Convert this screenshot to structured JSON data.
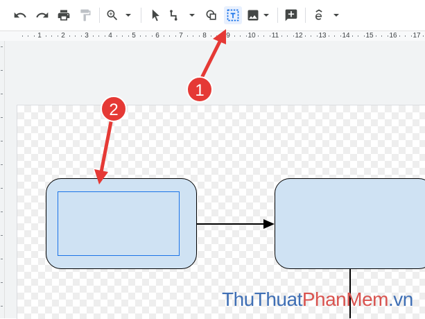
{
  "toolbar": {
    "buttons": [
      {
        "name": "undo",
        "icon": "undo-icon"
      },
      {
        "name": "redo",
        "icon": "redo-icon"
      },
      {
        "name": "print",
        "icon": "print-icon"
      },
      {
        "name": "paint-format",
        "icon": "paint-format-icon"
      },
      {
        "name": "zoom",
        "icon": "zoom-icon"
      },
      {
        "name": "select",
        "icon": "cursor-icon"
      },
      {
        "name": "line",
        "icon": "line-icon"
      },
      {
        "name": "shape",
        "icon": "shape-icon"
      },
      {
        "name": "text-box",
        "icon": "text-box-icon",
        "active": true
      },
      {
        "name": "image",
        "icon": "image-icon"
      },
      {
        "name": "comment",
        "icon": "add-comment-icon"
      },
      {
        "name": "more",
        "icon": "text-style-icon"
      }
    ]
  },
  "ruler": {
    "labels": [
      "1",
      "2",
      "3",
      "4",
      "5",
      "6",
      "7",
      "8",
      "9",
      "10",
      "11",
      "12",
      "13",
      "14",
      "15",
      "16",
      "17"
    ]
  },
  "annotations": [
    {
      "number": "1",
      "target": "text-box-button"
    },
    {
      "number": "2",
      "target": "text-box-outline"
    }
  ],
  "watermark": {
    "part1": "ThuThuat",
    "part2": "PhanMem",
    "part3": ".vn"
  },
  "colors": {
    "shape_fill": "#cfe2f3",
    "shape_border": "#000000",
    "selection_blue": "#1a73e8",
    "annotation_red": "#e53935",
    "watermark_blue": "#3f6fb5",
    "watermark_red": "#d9534f"
  }
}
